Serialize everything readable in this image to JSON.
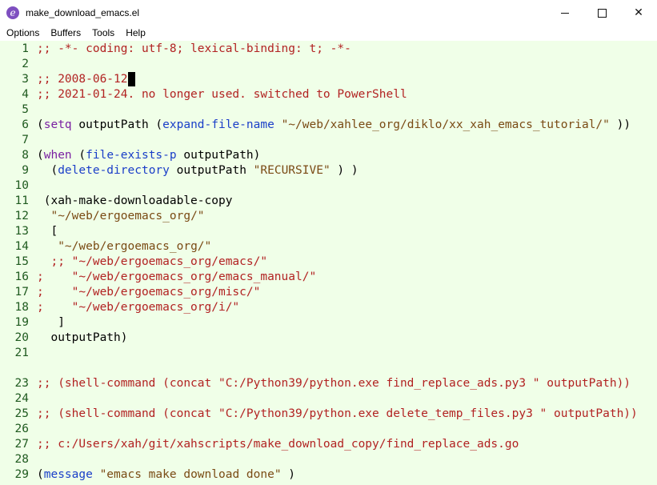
{
  "window": {
    "title": "make_download_emacs.el",
    "icon": "emacs-icon",
    "controls": {
      "minimize": "minimize-icon",
      "maximize": "maximize-icon",
      "close": "✕"
    }
  },
  "menu": [
    "Options",
    "Buffers",
    "Tools",
    "Help"
  ],
  "lines": [
    {
      "n": "1",
      "segs": [
        {
          "t": ";; -*- coding: utf-8; lexical-binding: t; -*-",
          "c": "cm"
        }
      ]
    },
    {
      "n": "2",
      "segs": []
    },
    {
      "n": "3",
      "segs": [
        {
          "t": ";; 2008-06-12",
          "c": "cm"
        }
      ],
      "cursor": true
    },
    {
      "n": "4",
      "segs": [
        {
          "t": ";; 2021-01-24. no longer used. switched to PowerShell",
          "c": "cm"
        }
      ]
    },
    {
      "n": "5",
      "segs": []
    },
    {
      "n": "6",
      "segs": [
        {
          "t": "(",
          "c": ""
        },
        {
          "t": "setq",
          "c": "kw"
        },
        {
          "t": " outputPath (",
          "c": ""
        },
        {
          "t": "expand-file-name",
          "c": "bi"
        },
        {
          "t": " ",
          "c": ""
        },
        {
          "t": "\"~/web/xahlee_org/diklo/xx_xah_emacs_tutorial/\"",
          "c": "st"
        },
        {
          "t": " ))",
          "c": ""
        }
      ]
    },
    {
      "n": "7",
      "segs": []
    },
    {
      "n": "8",
      "segs": [
        {
          "t": "(",
          "c": ""
        },
        {
          "t": "when",
          "c": "kw"
        },
        {
          "t": " (",
          "c": ""
        },
        {
          "t": "file-exists-p",
          "c": "bi"
        },
        {
          "t": " outputPath)",
          "c": ""
        }
      ]
    },
    {
      "n": "9",
      "segs": [
        {
          "t": "  (",
          "c": ""
        },
        {
          "t": "delete-directory",
          "c": "bi"
        },
        {
          "t": " outputPath ",
          "c": ""
        },
        {
          "t": "\"RECURSIVE\"",
          "c": "st"
        },
        {
          "t": " ) )",
          "c": ""
        }
      ]
    },
    {
      "n": "10",
      "segs": []
    },
    {
      "n": "11",
      "segs": [
        {
          "t": " (xah-make-downloadable-copy",
          "c": ""
        }
      ]
    },
    {
      "n": "12",
      "segs": [
        {
          "t": "  ",
          "c": ""
        },
        {
          "t": "\"~/web/ergoemacs_org/\"",
          "c": "st"
        }
      ]
    },
    {
      "n": "13",
      "segs": [
        {
          "t": "  [",
          "c": ""
        }
      ]
    },
    {
      "n": "14",
      "segs": [
        {
          "t": "   ",
          "c": ""
        },
        {
          "t": "\"~/web/ergoemacs_org/\"",
          "c": "st"
        }
      ]
    },
    {
      "n": "15",
      "segs": [
        {
          "t": "  ;; \"~/web/ergoemacs_org/emacs/\"",
          "c": "cm"
        }
      ]
    },
    {
      "n": "16",
      "segs": [
        {
          "t": ";    \"~/web/ergoemacs_org/emacs_manual/\"",
          "c": "cm"
        }
      ]
    },
    {
      "n": "17",
      "segs": [
        {
          "t": ";    \"~/web/ergoemacs_org/misc/\"",
          "c": "cm"
        }
      ]
    },
    {
      "n": "18",
      "segs": [
        {
          "t": ";    \"~/web/ergoemacs_org/i/\"",
          "c": "cm"
        }
      ]
    },
    {
      "n": "19",
      "segs": [
        {
          "t": "   ]",
          "c": ""
        }
      ]
    },
    {
      "n": "20",
      "segs": [
        {
          "t": "  outputPath)",
          "c": ""
        }
      ]
    },
    {
      "n": "21",
      "segs": []
    },
    {
      "n": "",
      "segs": []
    },
    {
      "n": "23",
      "segs": [
        {
          "t": ";; (shell-command (concat \"C:/Python39/python.exe find_replace_ads.py3 \" outputPath))",
          "c": "cm"
        }
      ]
    },
    {
      "n": "24",
      "segs": []
    },
    {
      "n": "25",
      "segs": [
        {
          "t": ";; (shell-command (concat \"C:/Python39/python.exe delete_temp_files.py3 \" outputPath))",
          "c": "cm"
        }
      ]
    },
    {
      "n": "26",
      "segs": []
    },
    {
      "n": "27",
      "segs": [
        {
          "t": ";; c:/Users/xah/git/xahscripts/make_download_copy/find_replace_ads.go",
          "c": "cm"
        }
      ]
    },
    {
      "n": "28",
      "segs": []
    },
    {
      "n": "29",
      "segs": [
        {
          "t": "(",
          "c": ""
        },
        {
          "t": "message",
          "c": "bi"
        },
        {
          "t": " ",
          "c": ""
        },
        {
          "t": "\"emacs make download done\"",
          "c": "st"
        },
        {
          "t": " )",
          "c": ""
        }
      ]
    }
  ]
}
